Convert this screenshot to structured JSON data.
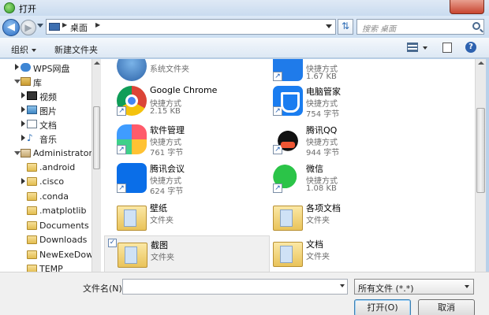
{
  "window": {
    "title": "打开"
  },
  "address": {
    "location": "桌面",
    "search_placeholder": "搜索 桌面"
  },
  "toolbar": {
    "organize": "组织",
    "new_folder": "新建文件夹",
    "help": "?"
  },
  "nav": {
    "items": [
      {
        "label": "WPS网盘",
        "icon": "cloud-icon"
      },
      {
        "label": "库",
        "icon": "library-icon"
      },
      {
        "label": "视频",
        "icon": "video-icon"
      },
      {
        "label": "图片",
        "icon": "pictures-icon"
      },
      {
        "label": "文档",
        "icon": "documents-icon"
      },
      {
        "label": "音乐",
        "icon": "music-icon"
      },
      {
        "label": "Administrator",
        "icon": "user-folder-icon"
      },
      {
        "label": ".android",
        "icon": "folder-icon"
      },
      {
        "label": ".cisco",
        "icon": "folder-icon"
      },
      {
        "label": ".conda",
        "icon": "folder-icon"
      },
      {
        "label": ".matplotlib",
        "icon": "folder-icon"
      },
      {
        "label": "Documents",
        "icon": "folder-icon"
      },
      {
        "label": "Downloads",
        "icon": "folder-icon"
      },
      {
        "label": "NewExeDown",
        "icon": "folder-icon"
      },
      {
        "label": "TEMP",
        "icon": "folder-icon"
      }
    ]
  },
  "files": [
    {
      "name": "",
      "type": "系统文件夹",
      "size": "",
      "icon": "system-icon"
    },
    {
      "name": "",
      "type": "快捷方式",
      "size": "1.67 KB",
      "icon": "app-shortcut-icon"
    },
    {
      "name": "Google Chrome",
      "type": "快捷方式",
      "size": "2.15 KB",
      "icon": "chrome-icon"
    },
    {
      "name": "电脑管家",
      "type": "快捷方式",
      "size": "754 字节",
      "icon": "pc-manager-icon"
    },
    {
      "name": "软件管理",
      "type": "快捷方式",
      "size": "761 字节",
      "icon": "software-manager-icon"
    },
    {
      "name": "腾讯QQ",
      "type": "快捷方式",
      "size": "944 字节",
      "icon": "qq-icon"
    },
    {
      "name": "腾讯会议",
      "type": "快捷方式",
      "size": "624 字节",
      "icon": "tencent-meeting-icon"
    },
    {
      "name": "微信",
      "type": "快捷方式",
      "size": "1.08 KB",
      "icon": "wechat-icon"
    },
    {
      "name": "壁纸",
      "type": "文件夹",
      "size": "",
      "icon": "folder-icon"
    },
    {
      "name": "各项文档",
      "type": "文件夹",
      "size": "",
      "icon": "folder-icon"
    },
    {
      "name": "截图",
      "type": "文件夹",
      "size": "",
      "icon": "folder-icon"
    },
    {
      "name": "文档",
      "type": "文件夹",
      "size": "",
      "icon": "folder-icon"
    }
  ],
  "bottom": {
    "filename_label": "文件名(N):",
    "filename_value": "",
    "filetype": "所有文件 (*.*)",
    "open_button": "打开(O)",
    "cancel_button": "取消"
  }
}
